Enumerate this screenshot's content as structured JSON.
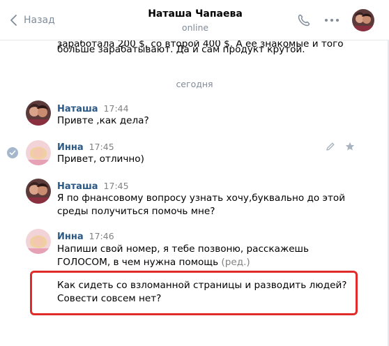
{
  "header": {
    "back_label": "Назад",
    "contact_name": "Наташа Чапаева",
    "status": "online"
  },
  "history_lines": [
    "заработала 200 $, со второй 400 $. А ее знакомые и того",
    "больше зарабатывают. Да и сам продукт крутой."
  ],
  "date_separator": "сегодня",
  "messages": [
    {
      "author": "Наташа",
      "time": "17:44",
      "lines": [
        "Привте ,как дела?"
      ]
    },
    {
      "author": "Инна",
      "time": "17:45",
      "lines": [
        "Привет, отлично)"
      ]
    },
    {
      "author": "Наташа",
      "time": "17:45",
      "lines": [
        "Я по фнансовому вопросу узнать хочу,буквально до этой",
        "среды получиться помочь мне?"
      ]
    },
    {
      "author": "Инна",
      "time": "17:46",
      "lines": [
        "Напиши свой номер, я тебе позвоню, расскажешь",
        "ГОЛОСОМ, в чем нужна помощь"
      ],
      "edited_label": "(ред.)"
    }
  ],
  "highlighted_lines": [
    "Как сидеть со взломанной страницы и разводить людей?",
    "Совести совсем нет?"
  ],
  "colors": {
    "author_link": "#2a5885",
    "muted": "#818c99",
    "highlight_border": "#e02b2b",
    "read_check": "#a4b7cc"
  },
  "icons": [
    "chevron-left-icon",
    "phone-icon",
    "more-dots-icon",
    "check-icon",
    "pencil-icon",
    "star-icon"
  ]
}
